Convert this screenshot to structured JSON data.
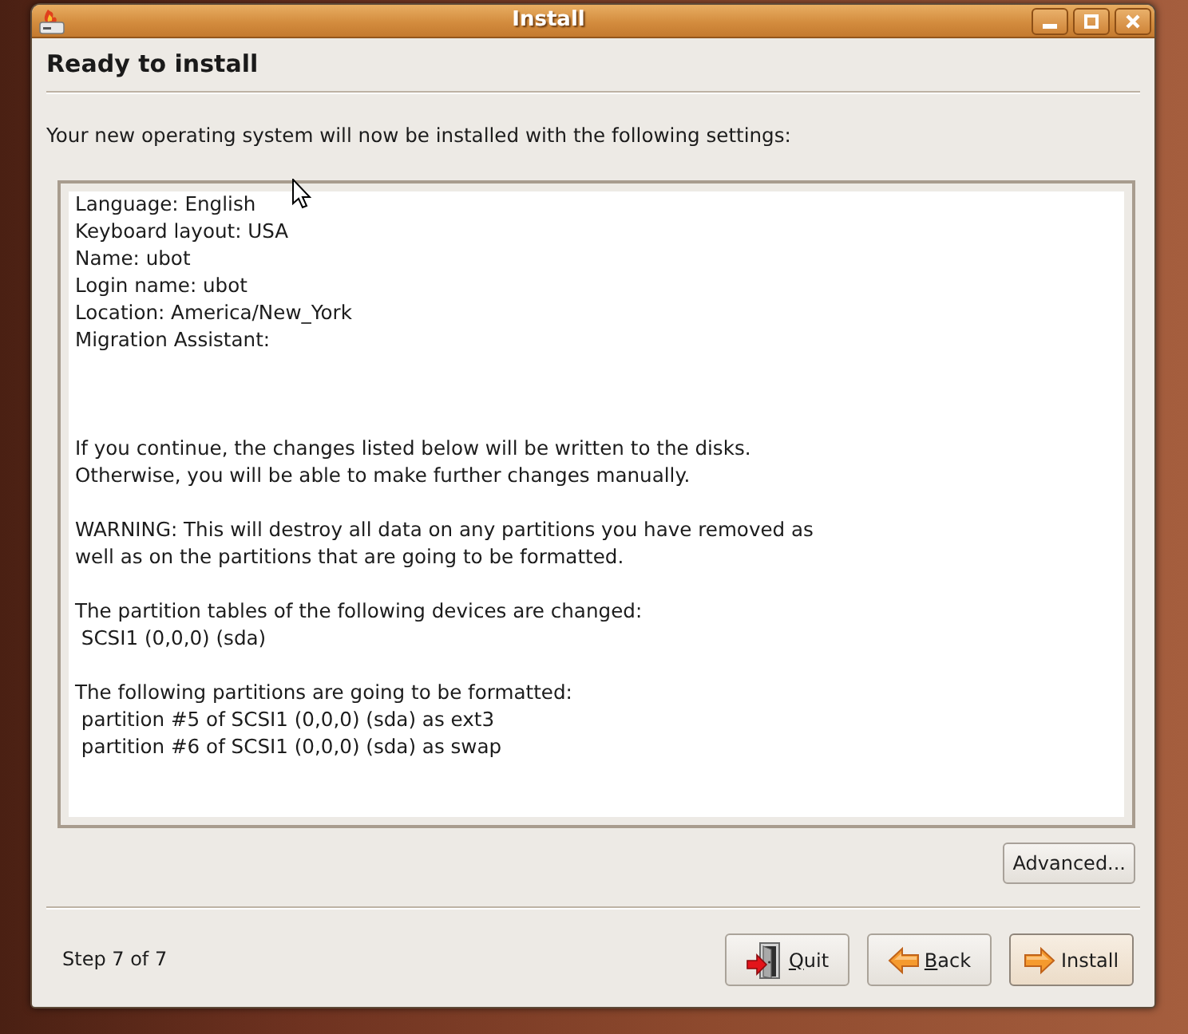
{
  "window": {
    "title": "Install"
  },
  "page": {
    "heading": "Ready to install",
    "intro": "Your new operating system will now be installed with the following settings:"
  },
  "summary": {
    "settings": [
      "Language: English",
      "Keyboard layout: USA",
      "Name: ubot",
      "Login name: ubot",
      "Location: America/New_York",
      "Migration Assistant:"
    ],
    "paragraphs": [
      {
        "lines": [
          "If you continue, the changes listed below will be written to the disks.",
          "Otherwise, you will be able to make further changes manually."
        ]
      },
      {
        "lines": [
          "WARNING: This will destroy all data on any partitions you have removed as",
          "well as on the partitions that are going to be formatted."
        ]
      },
      {
        "lines": [
          "The partition tables of the following devices are changed:",
          " SCSI1 (0,0,0) (sda)"
        ]
      },
      {
        "lines": [
          "The following partitions are going to be formatted:",
          " partition #5 of SCSI1 (0,0,0) (sda) as ext3",
          " partition #6 of SCSI1 (0,0,0) (sda) as swap"
        ]
      }
    ]
  },
  "advanced_button": {
    "label": "Advanced..."
  },
  "footer": {
    "step": "Step 7 of 7",
    "buttons": [
      {
        "kind": "quit",
        "label": "Quit",
        "access_key": true,
        "default": false
      },
      {
        "kind": "back",
        "label": "Back",
        "access_key": true,
        "default": false
      },
      {
        "kind": "install",
        "label": "Install",
        "access_key": false,
        "default": true
      }
    ]
  }
}
